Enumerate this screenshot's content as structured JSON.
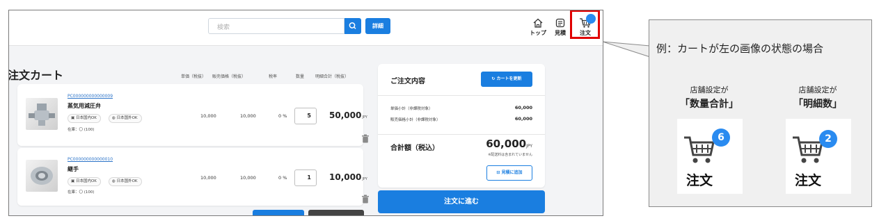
{
  "header": {
    "search_placeholder": "検索",
    "advanced_label": "詳細",
    "nav_top": "トップ",
    "nav_quote": "見積",
    "nav_order": "注文"
  },
  "cart": {
    "title": "注文カート",
    "columns": [
      "単価（税抜）",
      "販売価格（税抜）",
      "税率",
      "数量",
      "明細合計（税抜）"
    ],
    "items": [
      {
        "code": "PC000000000000009",
        "name": "蒸気用減圧弁",
        "tag_domestic": "日本国内OK",
        "tag_overseas": "日本国外OK",
        "stock": "在庫：〇 (100)",
        "unit_price": "10,000",
        "sale_price": "10,000",
        "tax_rate": "0 %",
        "quantity": "5",
        "total": "50,000",
        "currency": "JPY"
      },
      {
        "code": "PC000000000000010",
        "name": "継手",
        "tag_domestic": "日本国内OK",
        "tag_overseas": "日本国外OK",
        "stock": "在庫：〇 (100)",
        "unit_price": "10,000",
        "sale_price": "10,000",
        "tax_rate": "0 %",
        "quantity": "1",
        "total": "10,000",
        "currency": "JPY"
      }
    ]
  },
  "summary": {
    "title": "ご注文内容",
    "refresh_label": "カートを更新",
    "subtotal_unit_label": "単価小計（非課税対象）",
    "subtotal_unit_value": "60,000",
    "subtotal_sale_label": "販売価格小計（非課税対象）",
    "subtotal_sale_value": "60,000",
    "total_label": "合計額（税込）",
    "total_value": "60,000",
    "currency": "JPY",
    "shipping_note": "※配送料は含まれていません",
    "quote_label": "見積に追加",
    "proceed_label": "注文に進む"
  },
  "callout": {
    "text": "例：カートが左の画像の状態の場合",
    "left_label_1": "店舗設定が",
    "left_label_2": "「数量合計」",
    "left_badge": "6",
    "right_label_1": "店舗設定が",
    "right_label_2": "「明細数」",
    "right_badge": "2",
    "order_text": "注文"
  },
  "colors": {
    "accent": "#1a7ee0",
    "badge": "#2a8bf0",
    "highlight": "#e00000"
  }
}
